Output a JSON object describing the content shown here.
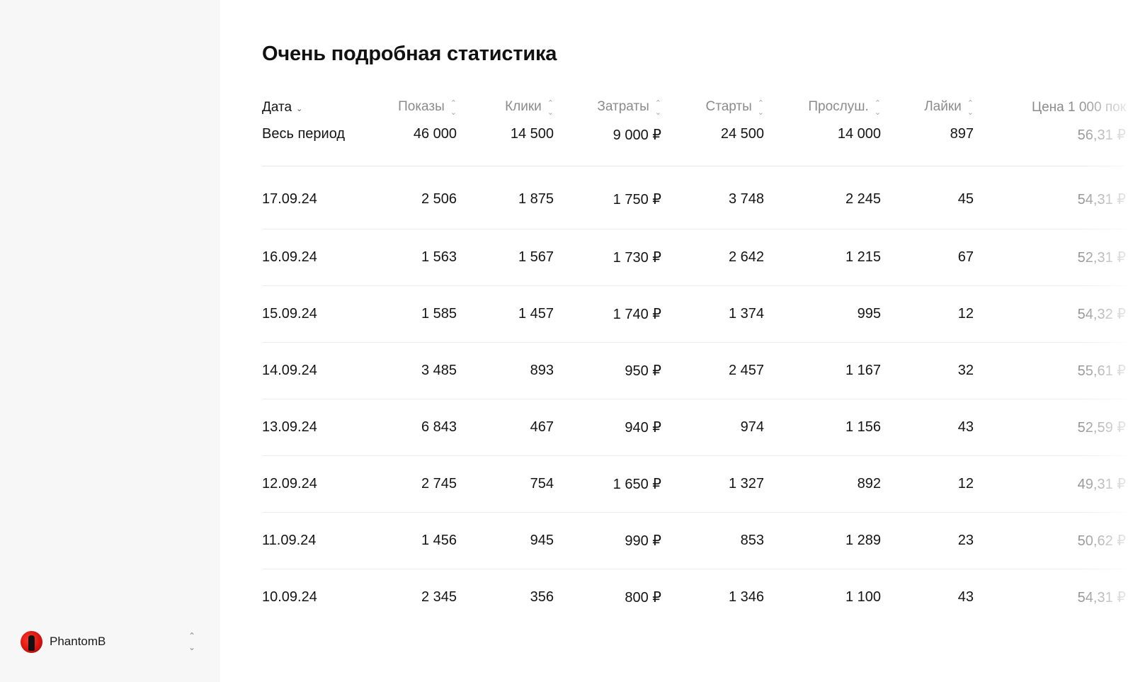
{
  "sidebar": {
    "account": {
      "name": "PhantomB",
      "avatar_icon": "avatar-icon",
      "switch_icon": "chevron-up-down-icon"
    }
  },
  "main": {
    "title": "Очень подробная статистика",
    "table": {
      "headers": [
        "Дата",
        "Показы",
        "Клики",
        "Затраты",
        "Старты",
        "Прослуш.",
        "Лайки",
        "Цена 1 000 пок"
      ],
      "sort_icon": "sort-icon",
      "total": [
        "Весь период",
        "46 000",
        "14 500",
        "9 000 ₽",
        "24 500",
        "14 000",
        "897",
        "56,31 ₽"
      ],
      "rows": [
        [
          "17.09.24",
          "2 506",
          "1 875",
          "1 750 ₽",
          "3 748",
          "2 245",
          "45",
          "54,31 ₽"
        ],
        [
          "16.09.24",
          "1 563",
          "1 567",
          "1 730 ₽",
          "2 642",
          "1 215",
          "67",
          "52,31 ₽"
        ],
        [
          "15.09.24",
          "1 585",
          "1 457",
          "1 740 ₽",
          "1 374",
          "995",
          "12",
          "54,32 ₽"
        ],
        [
          "14.09.24",
          "3 485",
          "893",
          "950 ₽",
          "2 457",
          "1 167",
          "32",
          "55,61 ₽"
        ],
        [
          "13.09.24",
          "6 843",
          "467",
          "940 ₽",
          "974",
          "1 156",
          "43",
          "52,59 ₽"
        ],
        [
          "12.09.24",
          "2 745",
          "754",
          "1 650 ₽",
          "1 327",
          "892",
          "12",
          "49,31 ₽"
        ],
        [
          "11.09.24",
          "1 456",
          "945",
          "990 ₽",
          "853",
          "1 289",
          "23",
          "50,62 ₽"
        ],
        [
          "10.09.24",
          "2 345",
          "356",
          "800 ₽",
          "1 346",
          "1 100",
          "43",
          "54,31 ₽"
        ]
      ]
    }
  }
}
